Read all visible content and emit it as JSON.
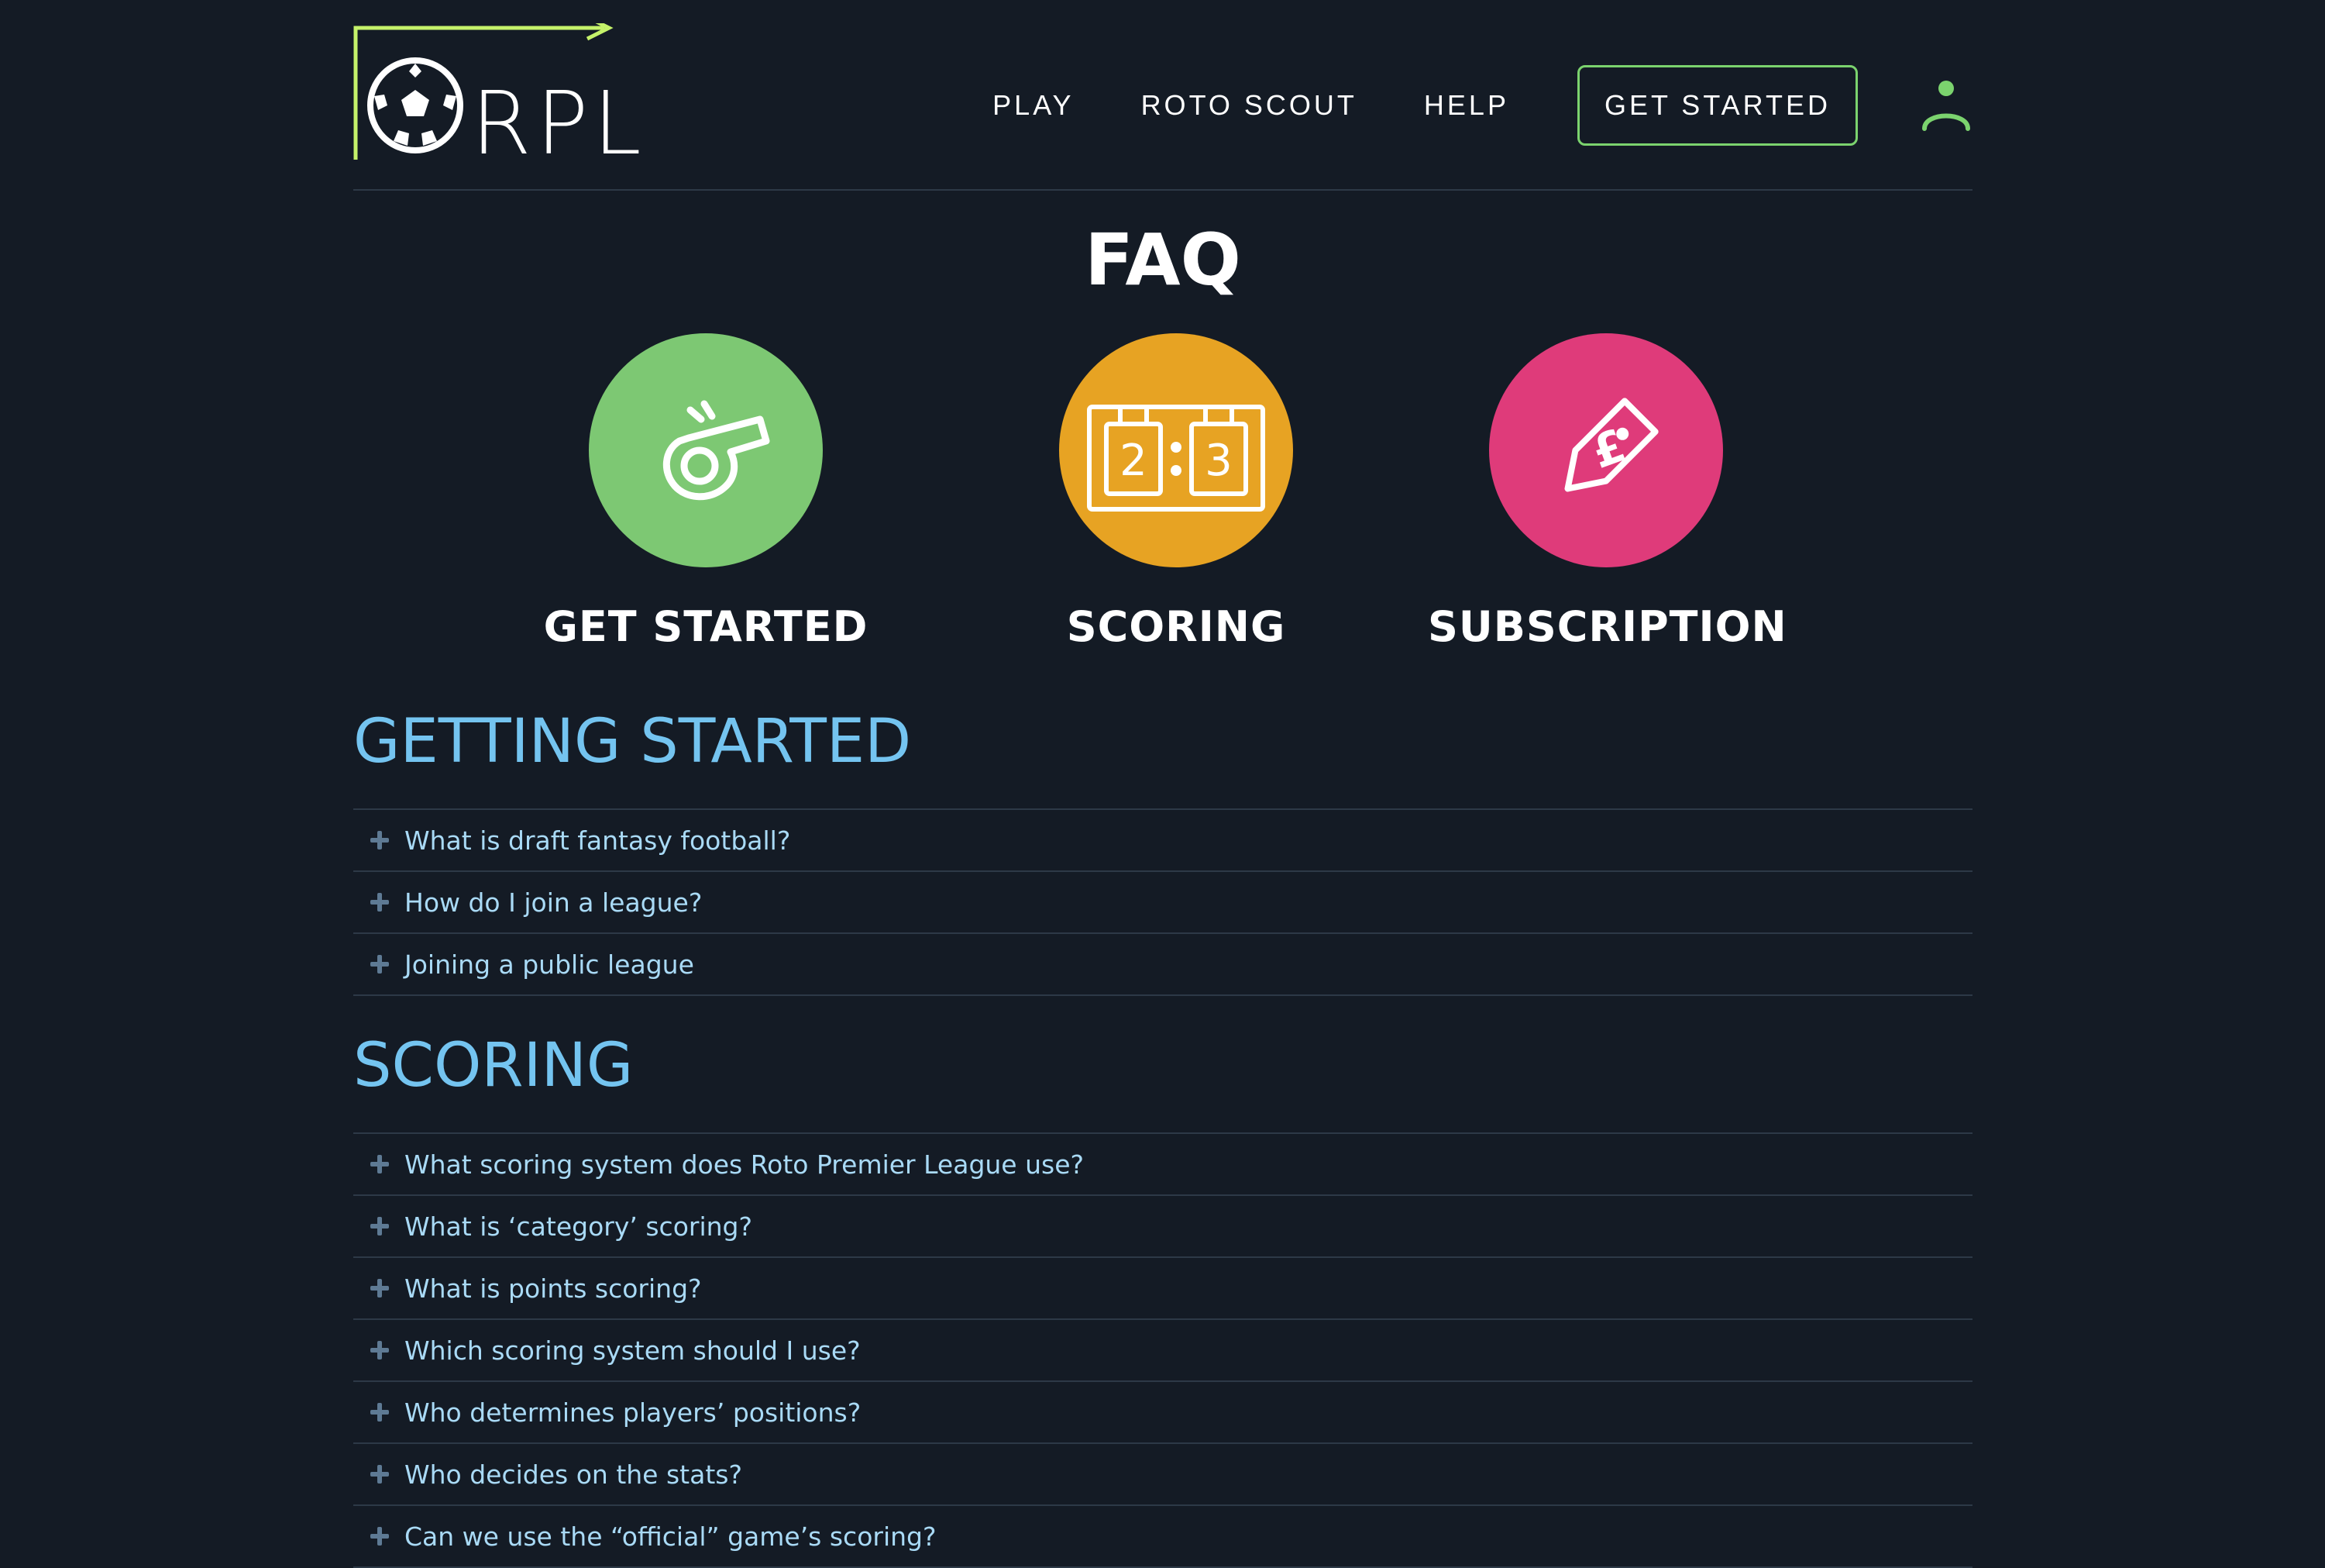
{
  "header": {
    "logo_text": "RPL",
    "nav": [
      {
        "label": "PLAY"
      },
      {
        "label": "ROTO SCOUT"
      },
      {
        "label": "HELP"
      }
    ],
    "cta_label": "GET STARTED"
  },
  "page_title": "FAQ",
  "categories": [
    {
      "label": "GET STARTED",
      "color": "#7dc873",
      "icon": "whistle-icon"
    },
    {
      "label": "SCORING",
      "color": "#e7a323",
      "icon": "scoreboard-icon",
      "score_home": "2",
      "score_away": "3"
    },
    {
      "label": "SUBSCRIPTION",
      "color": "#df3b7a",
      "icon": "price-tag-icon",
      "tag_symbol": "£"
    }
  ],
  "sections": [
    {
      "title": "GETTING STARTED",
      "questions": [
        "What is draft fantasy football?",
        "How do I join a league?",
        "Joining a public league"
      ]
    },
    {
      "title": "SCORING",
      "questions": [
        "What scoring system does Roto Premier League use?",
        "What is ‘category’ scoring?",
        "What is points scoring?",
        "Which scoring system should I use?",
        "Who determines players’ positions?",
        "Who decides on the stats?",
        "Can we use the “official” game’s scoring?"
      ]
    }
  ],
  "colors": {
    "background": "#141b25",
    "accent_green": "#7bd36e",
    "section_blue": "#74c4f0",
    "question_text": "#a9daf6",
    "divider": "#2d3947"
  }
}
